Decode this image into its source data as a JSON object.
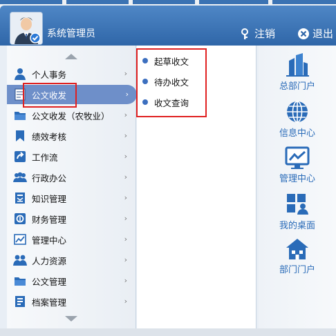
{
  "user": {
    "name": "系统管理员"
  },
  "header": {
    "logout_label": "注销",
    "exit_label": "退出"
  },
  "menu": {
    "items": [
      {
        "label": "个人事务",
        "icon": "person-icon"
      },
      {
        "label": "公文收发",
        "icon": "document-icon",
        "active": true
      },
      {
        "label": "公文收发（农牧业）",
        "icon": "folder-icon"
      },
      {
        "label": "绩效考核",
        "icon": "bookmark-icon"
      },
      {
        "label": "工作流",
        "icon": "workflow-icon"
      },
      {
        "label": "行政办公",
        "icon": "group-icon"
      },
      {
        "label": "知识管理",
        "icon": "knowledge-icon"
      },
      {
        "label": "财务管理",
        "icon": "finance-icon"
      },
      {
        "label": "管理中心",
        "icon": "chart-icon"
      },
      {
        "label": "人力资源",
        "icon": "people-icon"
      },
      {
        "label": "公文管理",
        "icon": "folder-icon"
      },
      {
        "label": "档案管理",
        "icon": "archive-icon"
      }
    ]
  },
  "submenu": {
    "items": [
      {
        "label": "起草收文"
      },
      {
        "label": "待办收文"
      },
      {
        "label": "收文查询"
      }
    ]
  },
  "shortcuts": [
    {
      "label": "总部门户",
      "icon": "buildings-icon"
    },
    {
      "label": "信息中心",
      "icon": "globe-icon"
    },
    {
      "label": "管理中心",
      "icon": "monitor-chart-icon"
    },
    {
      "label": "我的桌面",
      "icon": "desktop-icon"
    },
    {
      "label": "部门门户",
      "icon": "house-icon"
    }
  ],
  "colors": {
    "accent": "#2f66a8",
    "active": "#6e8fc9",
    "highlight": "#e02020",
    "link": "#2a6bb8"
  }
}
